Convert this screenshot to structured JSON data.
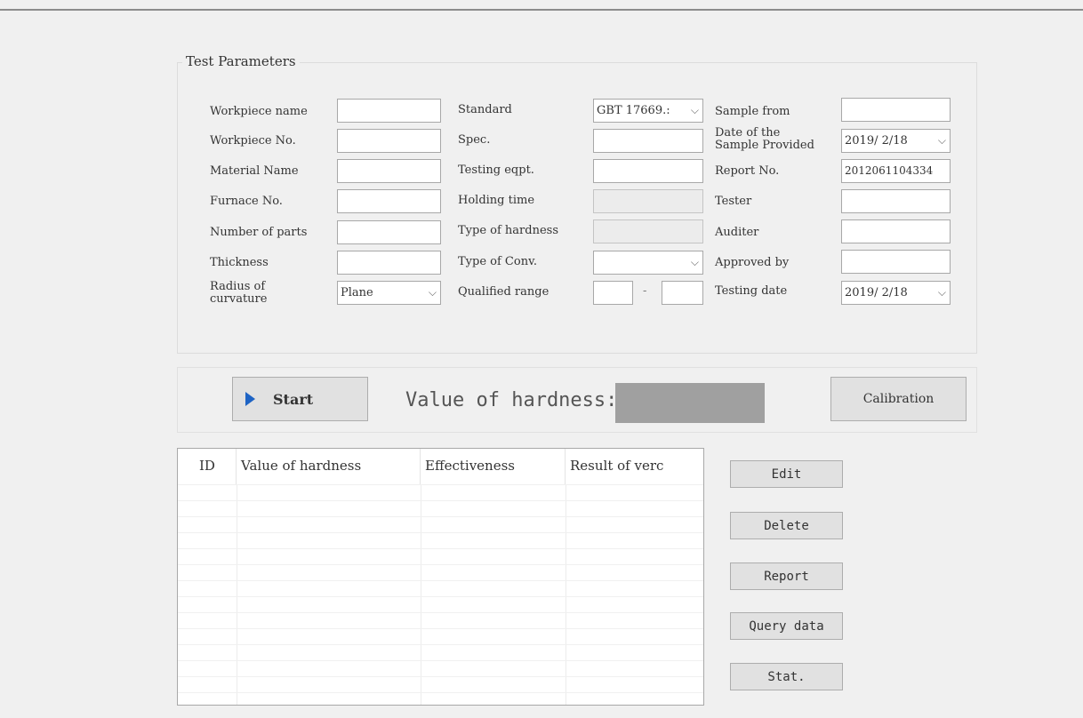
{
  "group": {
    "title": "Test Parameters"
  },
  "left": {
    "workpiece_name": {
      "label": "Workpiece name",
      "value": ""
    },
    "workpiece_no": {
      "label": "Workpiece No.",
      "value": ""
    },
    "material_name": {
      "label": "Material Name",
      "value": ""
    },
    "furnace_no": {
      "label": "Furnace No.",
      "value": ""
    },
    "number_of_parts": {
      "label": "Number of parts",
      "value": ""
    },
    "thickness": {
      "label": "Thickness",
      "value": ""
    },
    "radius": {
      "label": "Radius of\ncurvature",
      "value": "Plane"
    }
  },
  "middle": {
    "standard": {
      "label": "Standard",
      "value": "GBT 17669.:"
    },
    "spec": {
      "label": "Spec.",
      "value": ""
    },
    "testing_eqpt": {
      "label": "Testing eqpt.",
      "value": ""
    },
    "holding_time": {
      "label": "Holding time",
      "value": ""
    },
    "type_of_hardness": {
      "label": "Type of hardness",
      "value": ""
    },
    "type_of_conv": {
      "label": "Type of Conv.",
      "value": ""
    },
    "qualified_range": {
      "label": "Qualified range",
      "min": "",
      "max": "",
      "separator": "-"
    }
  },
  "right": {
    "sample_from": {
      "label": "Sample from",
      "value": ""
    },
    "date_sample": {
      "label": "Date of the\nSample Provided",
      "value": "2019/ 2/18"
    },
    "report_no": {
      "label": "Report No.",
      "value": "2012061104334"
    },
    "tester": {
      "label": "Tester",
      "value": ""
    },
    "auditer": {
      "label": "Auditer",
      "value": ""
    },
    "approved_by": {
      "label": "Approved by",
      "value": ""
    },
    "testing_date": {
      "label": "Testing date",
      "value": "2019/ 2/18"
    }
  },
  "toolbar": {
    "start_label": "Start",
    "hardness_label": "Value of hardness:",
    "hardness_value": "",
    "calibration_label": "Calibration"
  },
  "table": {
    "columns": [
      "ID",
      "Value of hardness",
      "Effectiveness",
      "Result of verc"
    ],
    "rows": []
  },
  "actions": {
    "edit": "Edit",
    "delete": "Delete",
    "report": "Report",
    "query": "Query data",
    "stat": "Stat."
  },
  "icons": {
    "start": "play-icon",
    "dropdown": "chevron-down-icon"
  },
  "colors": {
    "accent": "#1e63c4",
    "hardness_display": "#a0a0a0"
  }
}
